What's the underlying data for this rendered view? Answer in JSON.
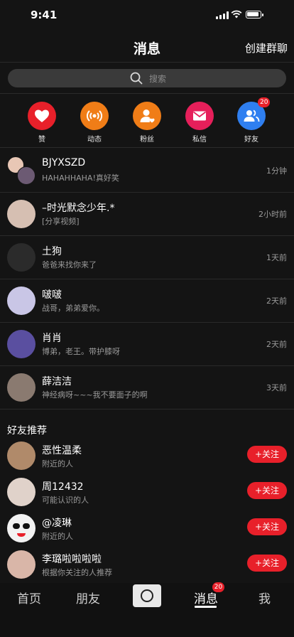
{
  "status_bar": {
    "time": "9:41"
  },
  "header": {
    "title": "消息",
    "action_label": "创建群聊"
  },
  "search": {
    "placeholder": "搜索"
  },
  "quick_actions": [
    {
      "label": "赞",
      "icon": "heart-icon",
      "color": "#e8202a"
    },
    {
      "label": "动态",
      "icon": "broadcast-icon",
      "color": "#f07d17"
    },
    {
      "label": "粉丝",
      "icon": "fan-user-icon",
      "color": "#f07d17"
    },
    {
      "label": "私信",
      "icon": "mail-icon",
      "color": "#e61f5a"
    },
    {
      "label": "好友",
      "icon": "friends-icon",
      "color": "#2f7ff0",
      "badge": "20"
    }
  ],
  "messages": [
    {
      "name": "BJYXSZD",
      "preview": "HAHAHHAHA!真好笑",
      "time": "1分钟"
    },
    {
      "name": "–时光默念少年.*",
      "preview": "[分享视频]",
      "time": "2小时前"
    },
    {
      "name": "土狗",
      "preview": "爸爸来找你来了",
      "time": "1天前"
    },
    {
      "name": "啵啵",
      "preview": "战哥，弟弟爱你。",
      "time": "2天前"
    },
    {
      "name": "肖肖",
      "preview": "博弟，老王。带护膝呀",
      "time": "2天前"
    },
    {
      "name": "薛洁洁",
      "preview": "神经病呀~~~我不要面子的啊",
      "time": "3天前"
    }
  ],
  "recommend": {
    "title": "好友推荐",
    "follow_label": "+关注",
    "items": [
      {
        "name": "恶性温柔",
        "reason": "附近的人"
      },
      {
        "name": "周12432",
        "reason": "可能认识的人"
      },
      {
        "name": "@凌琳",
        "reason": "附近的人"
      },
      {
        "name": "李璐啦啦啦啦",
        "reason": "根据你关注的人推荐"
      }
    ]
  },
  "tab_bar": {
    "home": "首页",
    "friends": "朋友",
    "messages": "消息",
    "messages_badge": "20",
    "me": "我"
  },
  "colors": {
    "accent": "#e8202a",
    "background": "#141414"
  }
}
